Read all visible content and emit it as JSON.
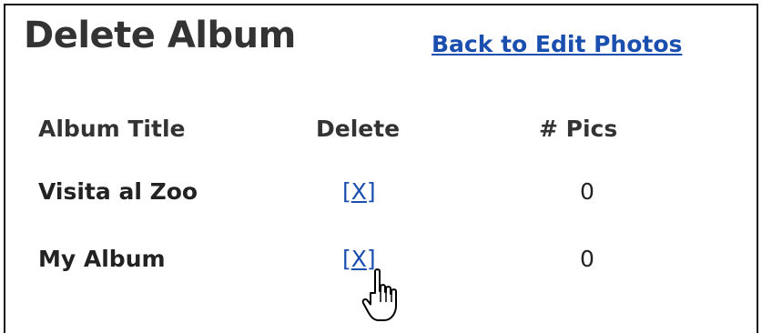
{
  "page": {
    "title": "Delete Album",
    "back_link": "Back to Edit Photos"
  },
  "table": {
    "headers": {
      "album_title": "Album Title",
      "delete": "Delete",
      "pics": "# Pics"
    },
    "rows": [
      {
        "title": "Visita al Zoo",
        "delete_open": "[",
        "delete_x": "X",
        "delete_close": "]",
        "pics": "0"
      },
      {
        "title": "My Album",
        "delete_open": "[",
        "delete_x": "X",
        "delete_close": "]",
        "pics": "0"
      }
    ]
  },
  "cursor": {
    "icon": "hand-pointer-icon"
  },
  "colors": {
    "link": "#1a4fb0",
    "text": "#222222",
    "title": "#333333",
    "border": "#111111"
  }
}
